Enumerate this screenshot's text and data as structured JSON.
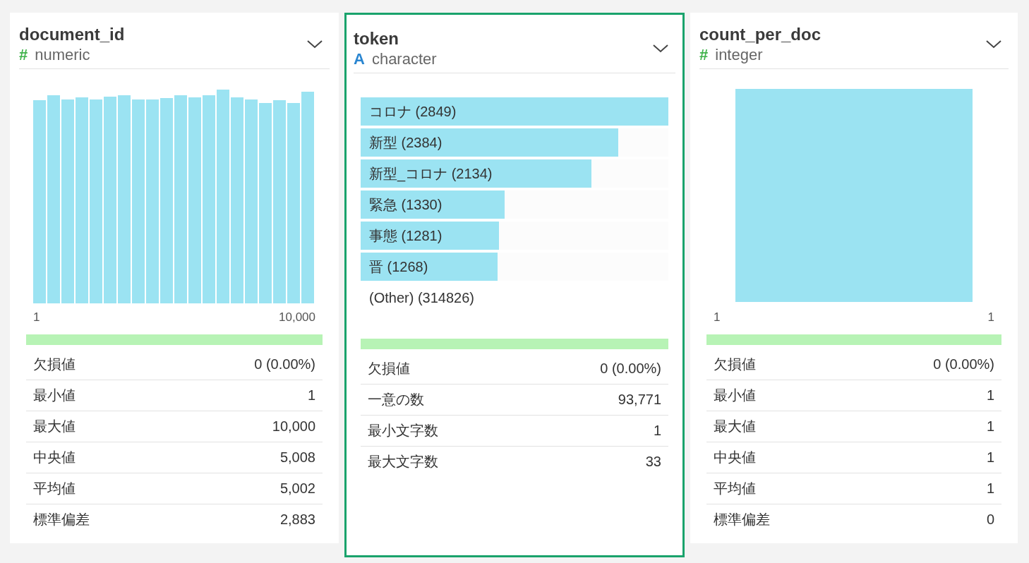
{
  "columns": [
    {
      "name": "document_id",
      "type_icon": "#",
      "color": "#3fb24a",
      "type": "numeric",
      "selected": false,
      "chart": {
        "kind": "histogram",
        "axis_labels": [
          "1",
          "10,000"
        ]
      },
      "completeness": {
        "level": 1
      },
      "stats": [
        {
          "label": "欠損値",
          "value": "0 (0.00%)"
        },
        {
          "label": "最小値",
          "value": "1"
        },
        {
          "label": "最大値",
          "value": "10,000"
        },
        {
          "label": "中央値",
          "value": "5,008"
        },
        {
          "label": "平均値",
          "value": "5,002"
        },
        {
          "label": "標準偏差",
          "value": "2,883"
        }
      ]
    },
    {
      "name": "token",
      "type_icon": "A",
      "color": "#2a86d1",
      "type": "character",
      "selected": true,
      "chart": {
        "kind": "top_values",
        "items": [
          {
            "kind": "bar",
            "label": "コロナ (2849)",
            "level": 1
          },
          {
            "kind": "bar",
            "label": "新型 (2384)",
            "level": 0.837
          },
          {
            "kind": "bar",
            "label": "新型_コロナ (2134)",
            "level": 0.749
          },
          {
            "kind": "bar",
            "label": "緊急 (1330)",
            "level": 0.467
          },
          {
            "kind": "bar",
            "label": "事態 (1281)",
            "level": 0.45
          },
          {
            "kind": "bar",
            "label": "晋 (1268)",
            "level": 0.445
          },
          {
            "kind": "other",
            "label": "(Other) (314826)"
          }
        ]
      },
      "completeness": {
        "level": 1
      },
      "stats": [
        {
          "label": "欠損値",
          "value": "0 (0.00%)"
        },
        {
          "label": "一意の数",
          "value": "93,771"
        },
        {
          "label": "最小文字数",
          "value": "1"
        },
        {
          "label": "最大文字数",
          "value": "33"
        }
      ]
    },
    {
      "name": "count_per_doc",
      "type_icon": "#",
      "color": "#3fb24a",
      "type": "integer",
      "selected": false,
      "chart": {
        "kind": "single_bar",
        "axis_labels": [
          "1",
          "1"
        ]
      },
      "completeness": {
        "level": 1
      },
      "stats": [
        {
          "label": "欠損値",
          "value": "0 (0.00%)"
        },
        {
          "label": "最小値",
          "value": "1"
        },
        {
          "label": "最大値",
          "value": "1"
        },
        {
          "label": "中央値",
          "value": "1"
        },
        {
          "label": "平均値",
          "value": "1"
        },
        {
          "label": "標準偏差",
          "value": "0"
        }
      ]
    }
  ]
}
